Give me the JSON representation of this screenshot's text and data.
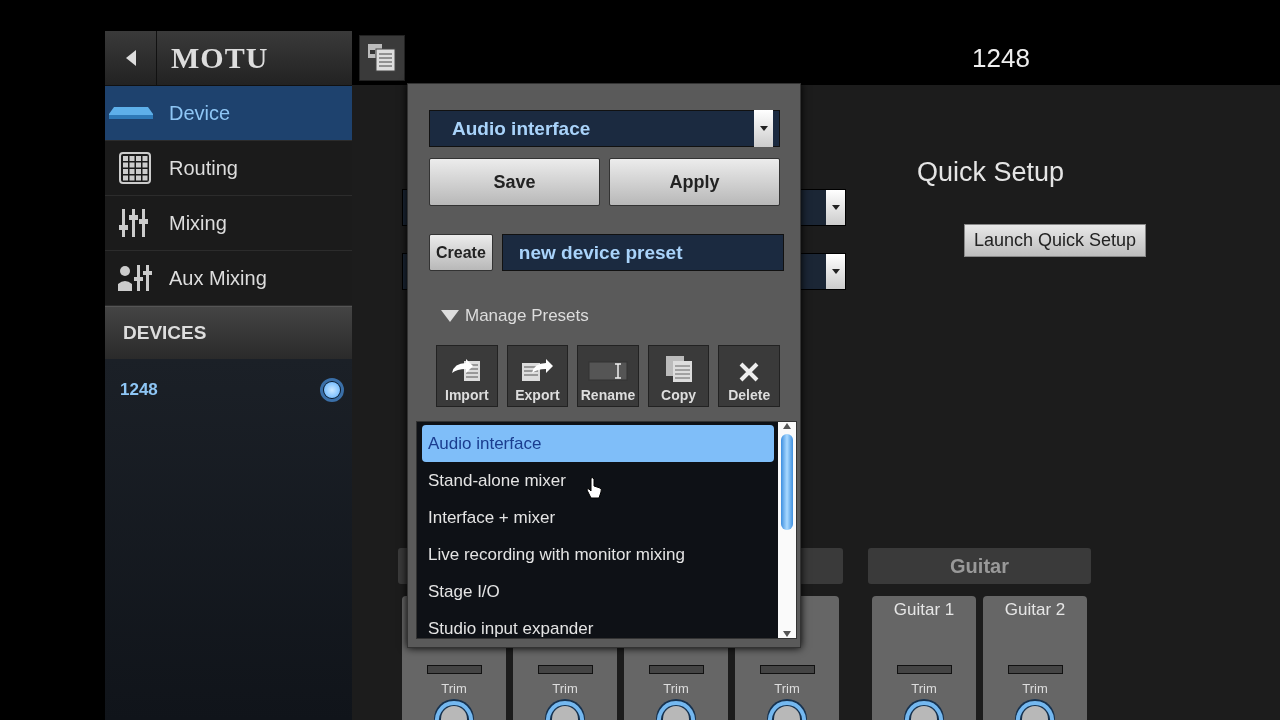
{
  "header": {
    "logo": "MOTU",
    "title": "1248"
  },
  "sidebar": {
    "items": [
      {
        "label": "Device",
        "selected": true
      },
      {
        "label": "Routing",
        "selected": false
      },
      {
        "label": "Mixing",
        "selected": false
      },
      {
        "label": "Aux Mixing",
        "selected": false
      }
    ],
    "devices": {
      "heading": "DEVICES",
      "items": [
        {
          "name": "1248",
          "selected": true
        }
      ]
    }
  },
  "quick_setup": {
    "title": "Quick Setup",
    "button": "Launch Quick Setup"
  },
  "mixer": {
    "groups": [
      {
        "strips": [
          {
            "trim_label": "Trim"
          },
          {
            "trim_label": "Trim"
          },
          {
            "trim_label": "Trim"
          },
          {
            "trim_label": "Trim"
          }
        ]
      },
      {
        "name": "Guitar",
        "strips": [
          {
            "name": "Guitar 1",
            "trim_label": "Trim"
          },
          {
            "name": "Guitar 2",
            "trim_label": "Trim"
          }
        ]
      }
    ]
  },
  "preset_popup": {
    "preset": "Audio interface",
    "buttons": [
      "Save",
      "Apply"
    ],
    "create_button": "Create",
    "name_value": "new device preset",
    "manage": {
      "label": "Manage Presets",
      "expanded": true
    },
    "actions": [
      {
        "label": "Import"
      },
      {
        "label": "Export"
      },
      {
        "label": "Rename"
      },
      {
        "label": "Copy"
      },
      {
        "label": "Delete"
      }
    ],
    "presets": [
      {
        "label": "Audio interface",
        "selected": true
      },
      {
        "label": "Stand-alone mixer",
        "selected": false
      },
      {
        "label": "Interface + mixer",
        "selected": false
      },
      {
        "label": "Live recording with monitor mixing",
        "selected": false
      },
      {
        "label": "Stage I/O",
        "selected": false
      },
      {
        "label": "Studio input expander",
        "selected": false
      }
    ]
  }
}
